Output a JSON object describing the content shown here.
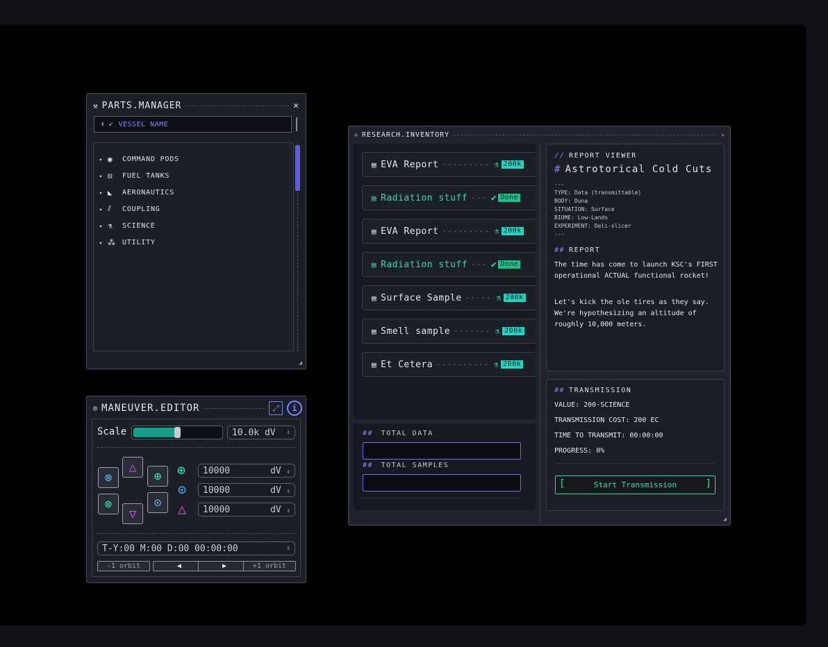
{
  "parts_manager": {
    "title": "PARTS.MANAGER",
    "vessel_name": "VESSEL NAME",
    "categories": [
      {
        "label": "COMMAND PODS",
        "icon": "capsule-icon",
        "glyph": "◉"
      },
      {
        "label": "FUEL TANKS",
        "icon": "fuel-tank-icon",
        "glyph": "⊟"
      },
      {
        "label": "AERONAUTICS",
        "icon": "wing-icon",
        "glyph": "◣"
      },
      {
        "label": "COUPLING",
        "icon": "coupling-icon",
        "glyph": "⫽"
      },
      {
        "label": "SCIENCE",
        "icon": "flask-icon",
        "glyph": "⚗"
      },
      {
        "label": "UTILITY",
        "icon": "utility-icon",
        "glyph": "⁂"
      }
    ]
  },
  "maneuver_editor": {
    "title": "MANEUVER.EDITOR",
    "scale_label": "Scale",
    "scale_level": 0.5,
    "scale_value": "10.0k dV",
    "dv_fields": [
      {
        "value": "10000",
        "unit": "dV",
        "icon": "prograde-icon",
        "color": "#2ee0a8"
      },
      {
        "value": "10000",
        "unit": "dV",
        "icon": "radial-icon",
        "color": "#4fb6ff"
      },
      {
        "value": "10000",
        "unit": "dV",
        "icon": "normal-icon",
        "color": "#d94fe0"
      }
    ],
    "time": "T-Y:00 M:00 D:00 00:00:00",
    "buttons": [
      "-1 orbit",
      "◀",
      "▶",
      "+1 orbit"
    ]
  },
  "research_inventory": {
    "title": "RESEARCH.INVENTORY",
    "items": [
      {
        "label": "EVA Report",
        "dots": "·········",
        "status": "200k",
        "done": false
      },
      {
        "label": "Radiation stuff",
        "dots": "···",
        "status": "Done",
        "done": true
      },
      {
        "label": "EVA Report",
        "dots": "·········",
        "status": "200k",
        "done": false
      },
      {
        "label": "Radiation stuff",
        "dots": "···",
        "status": "Done",
        "done": true
      },
      {
        "label": "Surface Sample",
        "dots": "·····",
        "status": "200k",
        "done": false
      },
      {
        "label": "Smell sample",
        "dots": "·······",
        "status": "200k",
        "done": false
      },
      {
        "label": "Et Cetera",
        "dots": "··········",
        "status": "200k",
        "done": false
      }
    ],
    "total_data_label": "TOTAL DATA",
    "total_samples_label": "TOTAL SAMPLES",
    "report": {
      "viewer_label": "REPORT VIEWER",
      "title": "Astrotorical Cold Cuts",
      "meta_open": "---",
      "meta": [
        "TYPE: Data (transmittable)",
        "BODY: Duna",
        "SITUATION: Surface",
        "BIOME: Low-Lands",
        "EXPERIMENT: Deli-slicer"
      ],
      "meta_close": "---",
      "section_label": "REPORT",
      "para1": "The time has come to launch KSC's FIRST operational ACTUAL functional rocket!",
      "para2": "Let's kick the ole tires as they say. We're hypothesizing an altitude of  roughly 10,000 meters."
    },
    "transmission": {
      "label": "TRANSMISSION",
      "value": "VALUE: 200-SCIENCE",
      "cost": "TRANSMISSION COST: 200 EC",
      "time": "TIME TO TRANSMIT: 00:00:00",
      "progress": "PROGRESS: 0%",
      "button": "Start Transmission"
    }
  },
  "colors": {
    "accent": "#7f86ff",
    "teal": "#1fd4c0",
    "green": "#2de0a5",
    "magenta": "#d94fe0"
  }
}
